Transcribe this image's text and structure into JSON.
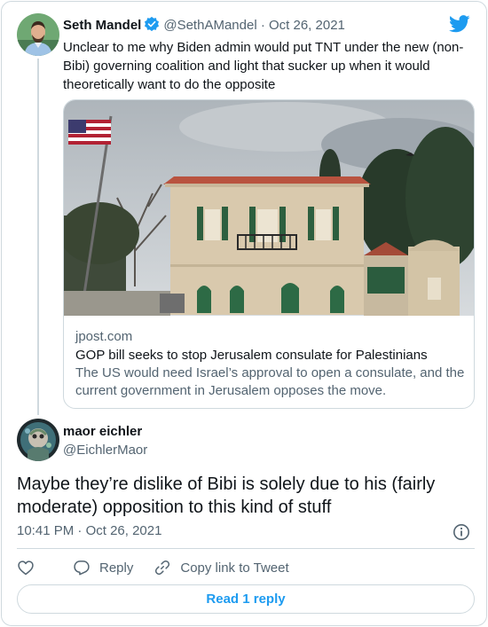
{
  "quoted_tweet": {
    "author_name": "Seth Mandel",
    "handle": "@SethAMandel",
    "separator": "·",
    "date": "Oct 26, 2021",
    "text": "Unclear to me why Biden admin would put TNT under the new (non-Bibi) governing coalition and light that sucker up when it would theoretically want to do the opposite",
    "card": {
      "domain": "jpost.com",
      "title": "GOP bill seeks to stop Jerusalem consulate for Palestinians",
      "description": "The US would need Israel’s approval to open a consulate, and the current government in Jerusalem opposes the move."
    }
  },
  "reply_tweet": {
    "author_name": "maor eichler",
    "handle": "@EichlerMaor",
    "text": "Maybe they’re dislike of Bibi is solely due to his (fairly moderate) opposition to this kind of stuff",
    "time": "10:41 PM",
    "separator": "·",
    "date": "Oct 26, 2021"
  },
  "actions": {
    "reply_label": "Reply",
    "copy_link_label": "Copy link to Tweet",
    "read_replies_label": "Read 1 reply"
  },
  "colors": {
    "accent": "#1d9bf0",
    "muted_text": "#536471",
    "border": "#cfd9de"
  },
  "icons": [
    "verified-badge-icon",
    "twitter-bird-icon",
    "info-icon",
    "heart-icon",
    "reply-icon",
    "link-icon"
  ]
}
